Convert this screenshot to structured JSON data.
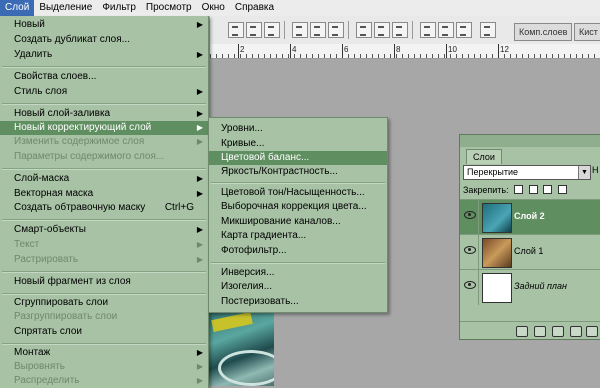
{
  "menubar": [
    "Слой",
    "Выделение",
    "Фильтр",
    "Просмотр",
    "Окно",
    "Справка"
  ],
  "toolbar": {
    "tab_comps": "Комп.слоев",
    "tab_hist": "Кист"
  },
  "ruler": {
    "labels": [
      "2",
      "4",
      "6",
      "8",
      "10",
      "12"
    ]
  },
  "main_menu": {
    "items": [
      {
        "label": "Новый",
        "arrow": "▶"
      },
      {
        "label": "Создать дубликат слоя..."
      },
      {
        "label": "Удалить",
        "arrow": "▶"
      },
      {
        "label": "Свойства слоев..."
      },
      {
        "label": "Стиль слоя",
        "arrow": "▶"
      },
      {
        "label": "Новый слой-заливка",
        "arrow": "▶"
      },
      {
        "label": "Новый корректирующий слой",
        "arrow": "▶"
      },
      {
        "label": "Изменить содержимое слоя",
        "arrow": "▶"
      },
      {
        "label": "Параметры содержимого слоя..."
      },
      {
        "label": "Слой-маска",
        "arrow": "▶"
      },
      {
        "label": "Векторная маска",
        "arrow": "▶"
      },
      {
        "label": "Создать обтравочную маску",
        "shortcut": "Ctrl+G"
      },
      {
        "label": "Смарт-объекты",
        "arrow": "▶"
      },
      {
        "label": "Текст",
        "arrow": "▶"
      },
      {
        "label": "Растрировать",
        "arrow": "▶"
      },
      {
        "label": "Новый фрагмент из слоя"
      },
      {
        "label": "Сгруппировать слои"
      },
      {
        "label": "Разгруппировать слои"
      },
      {
        "label": "Спрятать слои"
      },
      {
        "label": "Монтаж",
        "arrow": "▶"
      },
      {
        "label": "Выровнять",
        "arrow": "▶"
      },
      {
        "label": "Распределить",
        "arrow": "▶"
      }
    ]
  },
  "sub_menu": {
    "items": [
      {
        "label": "Уровни..."
      },
      {
        "label": "Кривые..."
      },
      {
        "label": "Цветовой баланс..."
      },
      {
        "label": "Яркость/Контрастность..."
      },
      {
        "label": "Цветовой тон/Насыщенность..."
      },
      {
        "label": "Выборочная коррекция цвета..."
      },
      {
        "label": "Микширование каналов..."
      },
      {
        "label": "Карта градиента..."
      },
      {
        "label": "Фотофильтр..."
      },
      {
        "label": "Инверсия..."
      },
      {
        "label": "Изогелия..."
      },
      {
        "label": "Постеризовать..."
      }
    ]
  },
  "layers_panel": {
    "tab": "Слои",
    "blend_mode": "Перекрытие",
    "opacity_trunc": "Н",
    "lock_label": "Закрепить:",
    "layers": [
      {
        "name": "Слой 2"
      },
      {
        "name": "Слой 1"
      },
      {
        "name": "Задний план"
      }
    ]
  },
  "colors": {
    "menu_bg": "#a7c2a5",
    "highlight": "#5f8e60",
    "canvas": "#a7a7a7",
    "menubar_active": "#3b6bb5"
  }
}
